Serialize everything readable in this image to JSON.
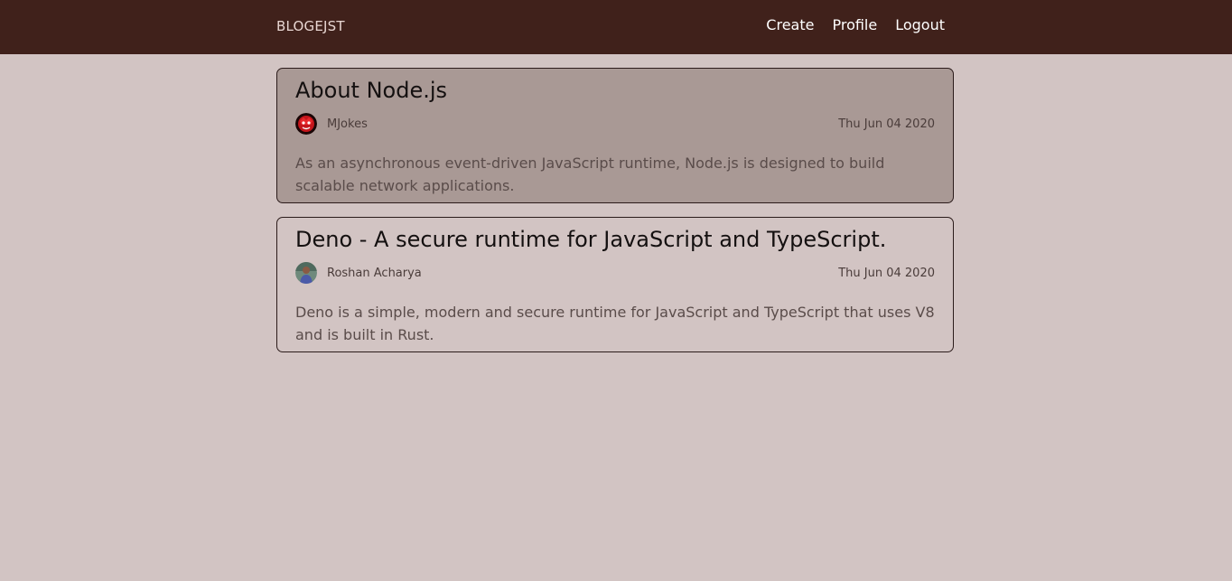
{
  "navbar": {
    "brand": "BLOGEJST",
    "links": [
      {
        "label": "Create"
      },
      {
        "label": "Profile"
      },
      {
        "label": "Logout"
      }
    ]
  },
  "posts": [
    {
      "title": "About Node.js",
      "author": "MJokes",
      "date": "Thu Jun 04 2020",
      "excerpt": "As an asynchronous event-driven JavaScript runtime, Node.js is designed to build scalable network applications.",
      "avatar_icon": "red-mascot-avatar"
    },
    {
      "title": "Deno - A secure runtime for JavaScript and TypeScript.",
      "author": "Roshan Acharya",
      "date": "Thu Jun 04 2020",
      "excerpt": "Deno is a simple, modern and secure runtime for JavaScript and TypeScript that uses V8 and is built in Rust.",
      "avatar_icon": "person-photo-avatar"
    }
  ],
  "colors": {
    "navbar_bg": "#40211b",
    "page_bg": "#d2c4c3",
    "hover_card_bg": "#a99995"
  }
}
